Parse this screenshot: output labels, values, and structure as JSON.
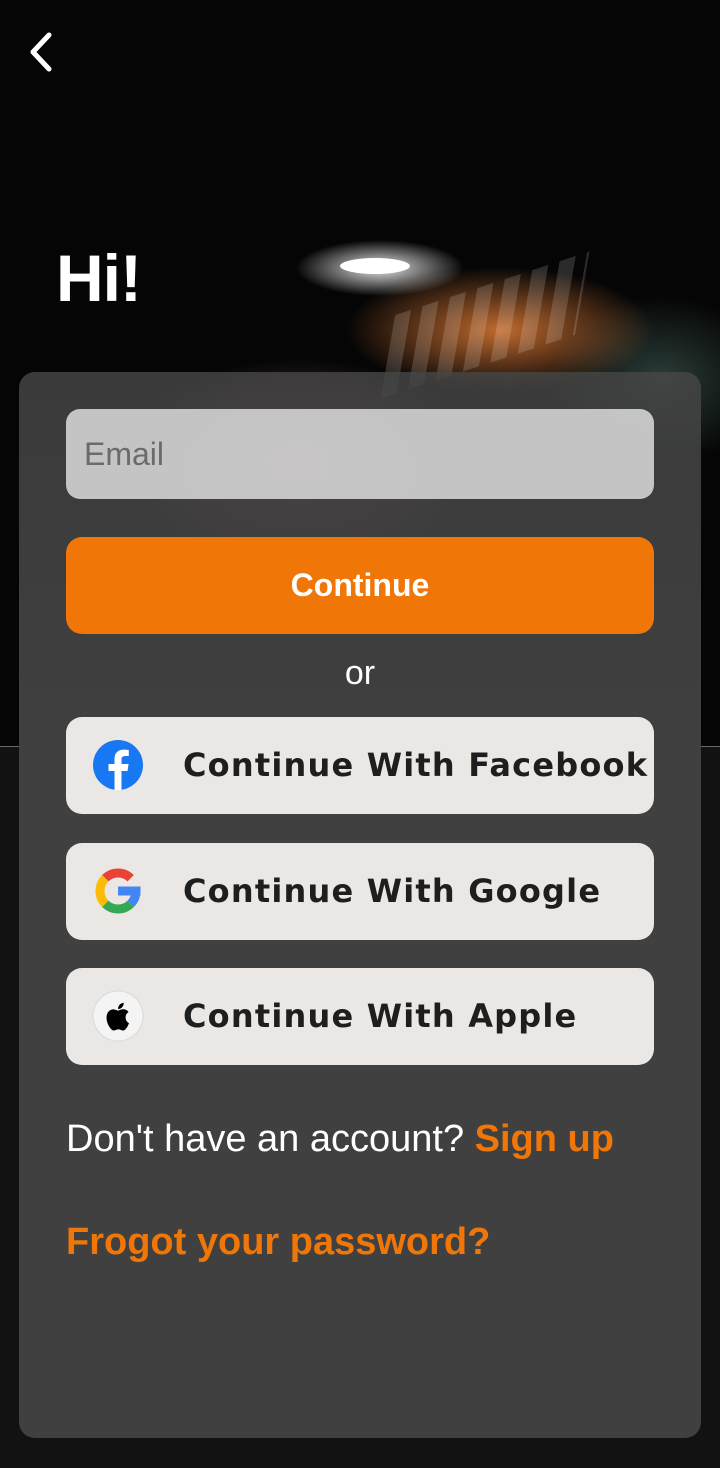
{
  "header": {
    "back_icon": "chevron-left-icon",
    "greeting": "Hi!"
  },
  "form": {
    "email_placeholder": "Email",
    "email_value": "",
    "continue_label": "Continue",
    "or_label": "or"
  },
  "social": [
    {
      "label": "Continue With Facebook",
      "icon": "facebook-icon"
    },
    {
      "label": "Continue With Google",
      "icon": "google-icon"
    },
    {
      "label": "Continue With Apple",
      "icon": "apple-icon"
    }
  ],
  "footer": {
    "no_account_text": "Don't have an account?",
    "signup_label": "Sign up",
    "forgot_label": "Frogot your password?"
  },
  "colors": {
    "accent": "#ef7607",
    "card": "#404040",
    "button_light": "#eae7e5",
    "facebook_blue": "#1877f2"
  }
}
